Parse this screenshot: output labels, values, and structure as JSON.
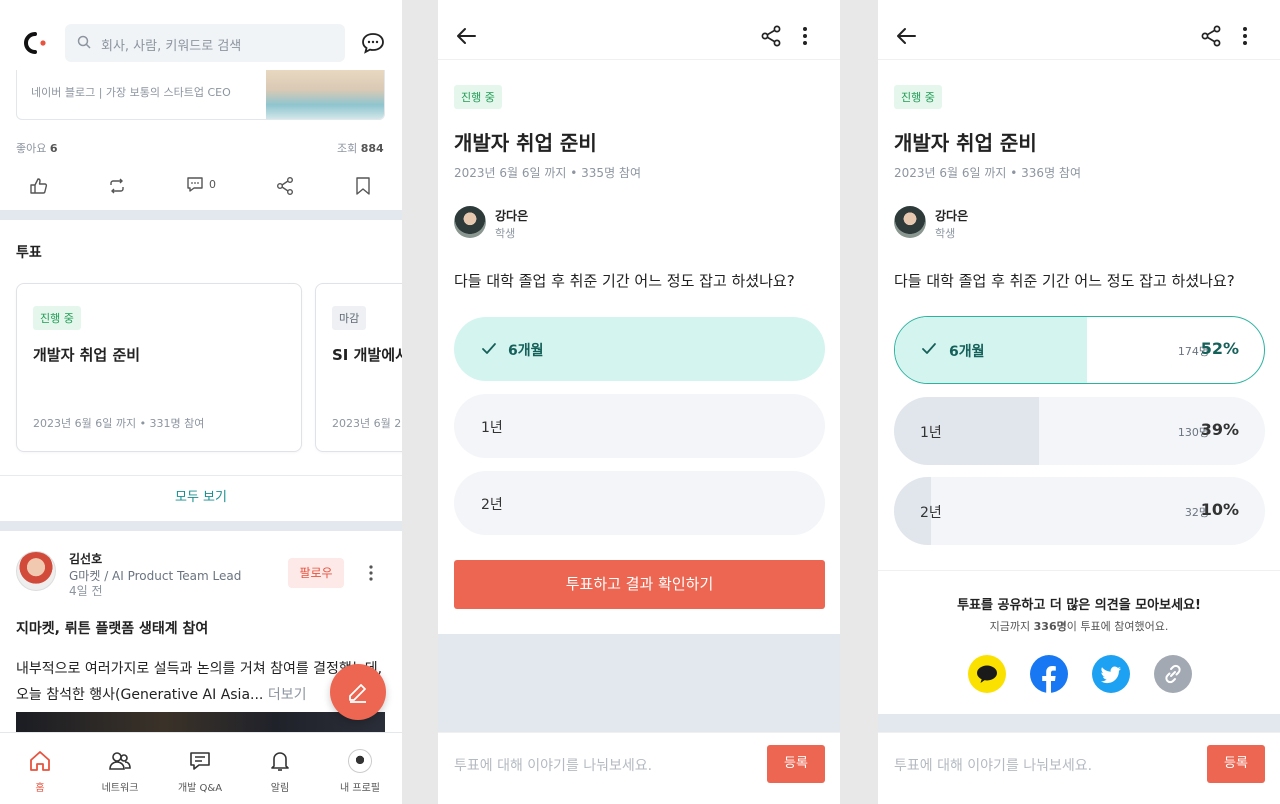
{
  "feed": {
    "search_placeholder": "회사, 사람, 키워드로 검색",
    "link_card_text": "네이버 블로그 | 가장 보통의 스타트업 CEO",
    "likes_label": "좋아요",
    "likes_count": "6",
    "views_label": "조회",
    "views_count": "884",
    "comment_count": "0",
    "poll_section_title": "투표",
    "polls": [
      {
        "status": "진행 중",
        "title": "개발자 취업 준비",
        "meta": "2023년 6월 6일 까지  •  331명 참여"
      },
      {
        "status": "마감",
        "title": "SI 개발에서",
        "meta": "2023년 6월 2"
      }
    ],
    "see_all": "모두 보기",
    "post": {
      "author": "김선호",
      "job": "G마켓 / AI Product Team Lead",
      "time": "4일 전",
      "follow": "팔로우",
      "title": "지마켓, 뤼튼 플랫폼 생태계 참여",
      "body": "내부적으로 여러가지로 설득과 논의를 거쳐 참여를 결정했는데, 오늘 참석한 행사(Generative AI Asia...",
      "more": "더보기"
    },
    "tabs": [
      {
        "label": "홈",
        "icon": "home-icon"
      },
      {
        "label": "네트워크",
        "icon": "network-icon"
      },
      {
        "label": "개발 Q&A",
        "icon": "qa-icon"
      },
      {
        "label": "알림",
        "icon": "bell-icon"
      },
      {
        "label": "내 프로필",
        "icon": "profile-icon"
      }
    ]
  },
  "vote": {
    "status": "진행 중",
    "title": "개발자 취업 준비",
    "meta": "2023년 6월 6일 까지  •  335명 참여",
    "author": "강다은",
    "role": "학생",
    "question": "다들 대학 졸업 후 취준 기간 어느 정도 잡고 하셨나요?",
    "options": [
      "6개월",
      "1년",
      "2년"
    ],
    "submit": "투표하고 결과 확인하기",
    "comment_placeholder": "투표에 대해 이야기를 나눠보세요.",
    "register": "등록"
  },
  "result": {
    "status": "진행 중",
    "title": "개발자 취업 준비",
    "meta": "2023년 6월 6일 까지  •  336명 참여",
    "author": "강다은",
    "role": "학생",
    "question": "다들 대학 졸업 후 취준 기간 어느 정도 잡고 하셨나요?",
    "options": [
      {
        "label": "6개월",
        "count": "174명",
        "percent": "52%",
        "ratio": 0.52
      },
      {
        "label": "1년",
        "count": "130명",
        "percent": "39%",
        "ratio": 0.39
      },
      {
        "label": "2년",
        "count": "32명",
        "percent": "10%",
        "ratio": 0.1
      }
    ],
    "share_title": "투표를 공유하고 더 많은 의견을 모아보세요!",
    "share_sub_prefix": "지금까지 ",
    "share_sub_count": "336명",
    "share_sub_suffix": "이 투표에 참여했어요.",
    "share_targets": [
      "kakao-icon",
      "facebook-icon",
      "twitter-icon",
      "link-icon"
    ],
    "comment_placeholder": "투표에 대해 이야기를 나눠보세요.",
    "register": "등록"
  },
  "colors": {
    "accent": "#ec6651",
    "teal": "#2bb3a0",
    "selected_fill": "#d4f4ef",
    "badge_green": "#1f9c55"
  }
}
